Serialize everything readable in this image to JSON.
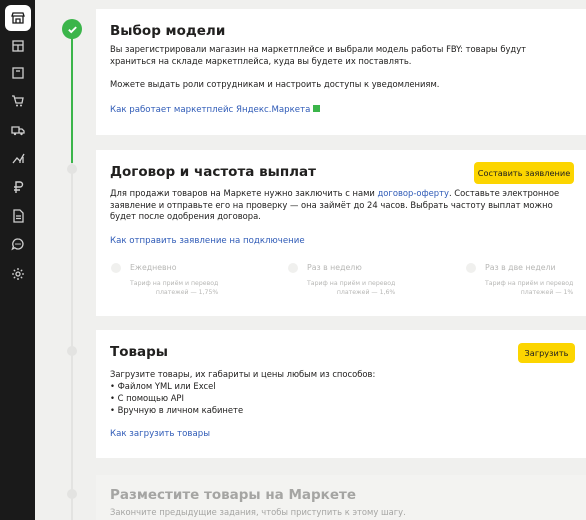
{
  "sidebar": {
    "items": [
      {
        "icon": "storefront-icon",
        "active": true
      },
      {
        "icon": "showcase-icon"
      },
      {
        "icon": "catalog-icon"
      },
      {
        "icon": "cart-icon"
      },
      {
        "icon": "truck-icon"
      },
      {
        "icon": "analytics-icon"
      },
      {
        "icon": "ruble-icon"
      },
      {
        "icon": "document-icon"
      },
      {
        "icon": "chat-icon"
      },
      {
        "icon": "gear-icon"
      }
    ]
  },
  "steps": {
    "model": {
      "title": "Выбор модели",
      "text_line1": "Вы зарегистрировали магазин на маркетплейсе и выбрали модель работы FBY: товары будут",
      "text_line2": "храниться на складе маркетплейса, куда вы будете их поставлять.",
      "text2": "Можете выдать роли сотрудникам и настроить доступы к уведомлениям.",
      "link": "Как работает маркетплейс Яндекс.Маркета"
    },
    "contract": {
      "title": "Договор и частота выплат",
      "button": "Составить заявление",
      "text_line1_pre": "Для продажи товаров на Маркете нужно заключить с нами ",
      "text_line1_link": "договор-оферту",
      "text_line1_post": ". Составьте электронное",
      "text_line2": "заявление и отправьте его на проверку — она займёт до 24 часов. Выбрать частоту выплат можно",
      "text_line3": "будет после одобрения договора.",
      "link": "Как отправить заявление на подключение",
      "options": [
        {
          "label": "Ежедневно",
          "sub1": "Тариф на приём и перевод",
          "sub2": "платежей — 1,75%"
        },
        {
          "label": "Раз в неделю",
          "sub1": "Тариф на приём и перевод",
          "sub2": "платежей — 1,6%"
        },
        {
          "label": "Раз в две недели",
          "sub1": "Тариф на приём и перевод",
          "sub2": "платежей — 1%"
        }
      ]
    },
    "goods": {
      "title": "Товары",
      "button": "Загрузить",
      "intro": "Загрузите товары, их габариты и цены любым из способов:",
      "bullets": [
        "• Файлом YML или Excel",
        "• С помощью API",
        "• Вручную  в личном кабинете"
      ],
      "link": "Как загрузить товары"
    },
    "publish": {
      "title": "Разместите товары на Маркете",
      "text": "Закончите предыдущие задания, чтобы приступить к этому шагу."
    }
  }
}
